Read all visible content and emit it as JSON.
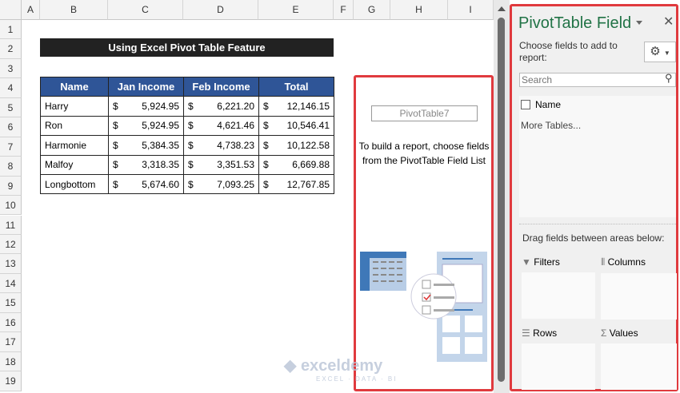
{
  "columns": [
    "A",
    "B",
    "C",
    "D",
    "E",
    "F",
    "G",
    "H",
    "I"
  ],
  "rows": [
    "1",
    "2",
    "3",
    "4",
    "5",
    "6",
    "7",
    "8",
    "9",
    "10",
    "11",
    "12",
    "13",
    "14",
    "15",
    "16",
    "17",
    "18",
    "19"
  ],
  "title": "Using Excel Pivot Table Feature",
  "table": {
    "headers": [
      "Name",
      "Jan Income",
      "Feb Income",
      "Total"
    ],
    "currency": "$",
    "rows": [
      {
        "name": "Harry",
        "jan": "5,924.95",
        "feb": "6,221.20",
        "total": "12,146.15"
      },
      {
        "name": "Ron",
        "jan": "5,924.95",
        "feb": "4,621.46",
        "total": "10,546.41"
      },
      {
        "name": "Harmonie",
        "jan": "5,384.35",
        "feb": "4,738.23",
        "total": "10,122.58"
      },
      {
        "name": "Malfoy",
        "jan": "3,318.35",
        "feb": "3,351.53",
        "total": "6,669.88"
      },
      {
        "name": "Longbottom",
        "jan": "5,674.60",
        "feb": "7,093.25",
        "total": "12,767.85"
      }
    ]
  },
  "pivot": {
    "name": "PivotTable7",
    "hint": "To build a report, choose fields from the PivotTable Field List"
  },
  "panel": {
    "title": "PivotTable Field",
    "choose": "Choose fields to add to report:",
    "search_placeholder": "Search",
    "field": "Name",
    "more_tables": "More Tables...",
    "drag": "Drag fields between areas below:",
    "areas": [
      "Filters",
      "Columns",
      "Rows",
      "Values"
    ]
  },
  "watermark": {
    "brand": "exceldemy",
    "tagline": "EXCEL · DATA · BI"
  },
  "colors": {
    "header_blue": "#2f5597",
    "highlight_red": "#e03a3e",
    "title_green": "#217346"
  }
}
